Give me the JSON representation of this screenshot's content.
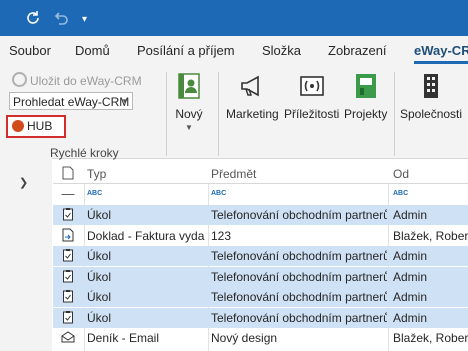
{
  "titlebar": {
    "bg": "#1e69b5",
    "refresh_icon": "refresh-icon",
    "undo_icon": "undo-icon",
    "qat_icon": "customize-qat-icon"
  },
  "tabs": [
    "Soubor",
    "Domů",
    "Posílání a příjem",
    "Složka",
    "Zobrazení",
    "eWay-CRM"
  ],
  "ribbon": {
    "save_label": "Uložit do eWay-CRM",
    "search_value": "Prohledat eWay-CRM",
    "hub_label": "HUB",
    "group_label": "Rychlé kroky",
    "new_label": "Nový",
    "marketing_label": "Marketing",
    "prilezitosti_label": "Příležitosti",
    "projekty_label": "Projekty",
    "spolecnosti_label": "Společnosti"
  },
  "table": {
    "columns": [
      "Typ",
      "Předmět",
      "Od"
    ],
    "filter_row": [
      "ABC",
      "ABC",
      "ABC"
    ],
    "rows": [
      {
        "icon": "task-icon",
        "typ": "Úkol",
        "predmet": "Telefonování obchodním partnerům",
        "od": "Admin",
        "selected": true
      },
      {
        "icon": "document-icon",
        "typ": "Doklad - Faktura vydaná",
        "predmet": "123",
        "od": "Blažek, Robert",
        "selected": false
      },
      {
        "icon": "task-icon",
        "typ": "Úkol",
        "predmet": "Telefonování obchodním partnerům",
        "od": "Admin",
        "selected": true
      },
      {
        "icon": "task-icon",
        "typ": "Úkol",
        "predmet": "Telefonování obchodním partnerům",
        "od": "Admin",
        "selected": true
      },
      {
        "icon": "task-icon",
        "typ": "Úkol",
        "predmet": "Telefonování obchodním partnerům",
        "od": "Admin",
        "selected": true
      },
      {
        "icon": "task-icon",
        "typ": "Úkol",
        "predmet": "Telefonování obchodním partnerům",
        "od": "Admin",
        "selected": true
      },
      {
        "icon": "email-icon",
        "typ": "Deník - Email",
        "predmet": "Nový design",
        "od": "Blažek, Robert",
        "selected": false
      }
    ]
  }
}
